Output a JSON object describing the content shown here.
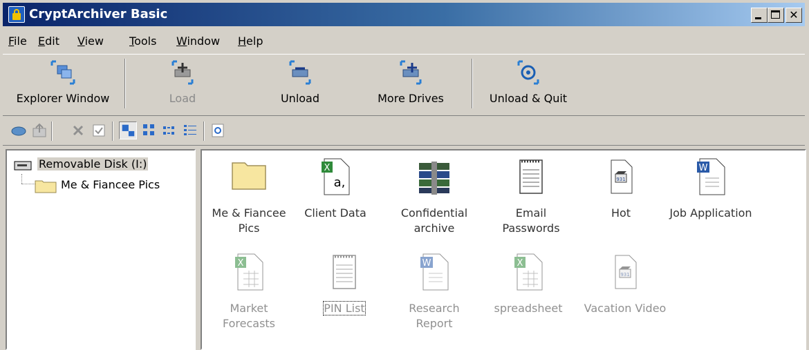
{
  "window": {
    "title": "CryptArchiver Basic"
  },
  "menu": [
    {
      "label": "File",
      "mnemonic": "F",
      "rest": "ile"
    },
    {
      "label": "Edit",
      "mnemonic": "E",
      "rest": "dit"
    },
    {
      "label": "View",
      "mnemonic": "V",
      "rest": "iew"
    },
    {
      "label": "Tools",
      "mnemonic": "T",
      "rest": "ools"
    },
    {
      "label": "Window",
      "mnemonic": "W",
      "rest": "indow"
    },
    {
      "label": "Help",
      "mnemonic": "H",
      "rest": "elp"
    }
  ],
  "toolbar": {
    "explorer_window": "Explorer Window",
    "load": "Load",
    "unload": "Unload",
    "more_drives": "More Drives",
    "unload_quit": "Unload & Quit"
  },
  "tree": {
    "root": "Removable Disk (I:)",
    "children": [
      "Me & Fiancee Pics"
    ]
  },
  "files": [
    {
      "name": "Me & Fiancee Pics",
      "type": "folder",
      "enabled": true
    },
    {
      "name": "Client Data",
      "type": "excel",
      "enabled": true
    },
    {
      "name": "Confidential archive",
      "type": "archive",
      "enabled": true
    },
    {
      "name": "Email Passwords",
      "type": "notepad",
      "enabled": true
    },
    {
      "name": "Hot",
      "type": "video",
      "enabled": true
    },
    {
      "name": "Job Application",
      "type": "word",
      "enabled": true
    },
    {
      "name": "Market Forecasts",
      "type": "excel",
      "enabled": false
    },
    {
      "name": "PIN List",
      "type": "notepad",
      "enabled": false
    },
    {
      "name": "Research Report",
      "type": "word",
      "enabled": false
    },
    {
      "name": "spreadsheet",
      "type": "excel",
      "enabled": false
    },
    {
      "name": "Vacation Video",
      "type": "video",
      "enabled": false
    }
  ],
  "colors": {
    "title_gradient_start": "#0a246a",
    "title_gradient_end": "#a6caf0",
    "chrome": "#d4d0c8"
  }
}
